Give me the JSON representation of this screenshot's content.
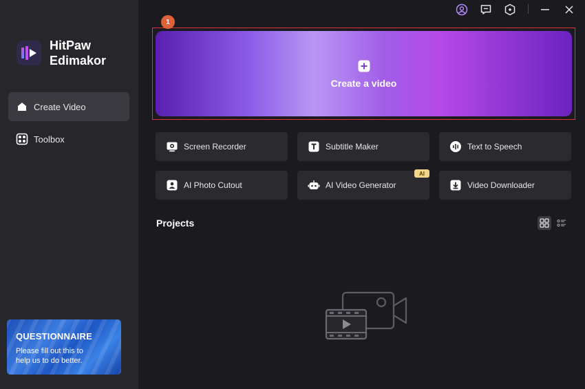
{
  "app": {
    "brand_line1": "HitPaw",
    "brand_line2": "Edimakor"
  },
  "sidebar": {
    "items": [
      {
        "label": "Create Video",
        "icon": "home-icon",
        "active": true
      },
      {
        "label": "Toolbox",
        "icon": "toolbox-icon",
        "active": false
      }
    ],
    "questionnaire": {
      "title": "QUESTIONNAIRE",
      "subtitle": "Please fill out this to help us to do better."
    }
  },
  "topbar": {
    "icons": [
      "account-icon",
      "feedback-icon",
      "settings-icon",
      "minimize-icon",
      "close-icon"
    ]
  },
  "main": {
    "step_badge": "1",
    "create_label": "Create a video",
    "tools": [
      {
        "label": "Screen Recorder",
        "icon": "screen-recorder-icon"
      },
      {
        "label": "Subtitle Maker",
        "icon": "subtitle-icon"
      },
      {
        "label": "Text to Speech",
        "icon": "text-to-speech-icon"
      },
      {
        "label": "AI Photo Cutout",
        "icon": "photo-cutout-icon"
      },
      {
        "label": "AI Video Generator",
        "icon": "robot-icon",
        "badge": "AI"
      },
      {
        "label": "Video Downloader",
        "icon": "download-icon"
      }
    ],
    "projects_title": "Projects"
  },
  "colors": {
    "accent": "#8a4ce6",
    "highlight": "#e0343a",
    "badge": "#e0623a",
    "ai_badge": "#f3d68a"
  }
}
